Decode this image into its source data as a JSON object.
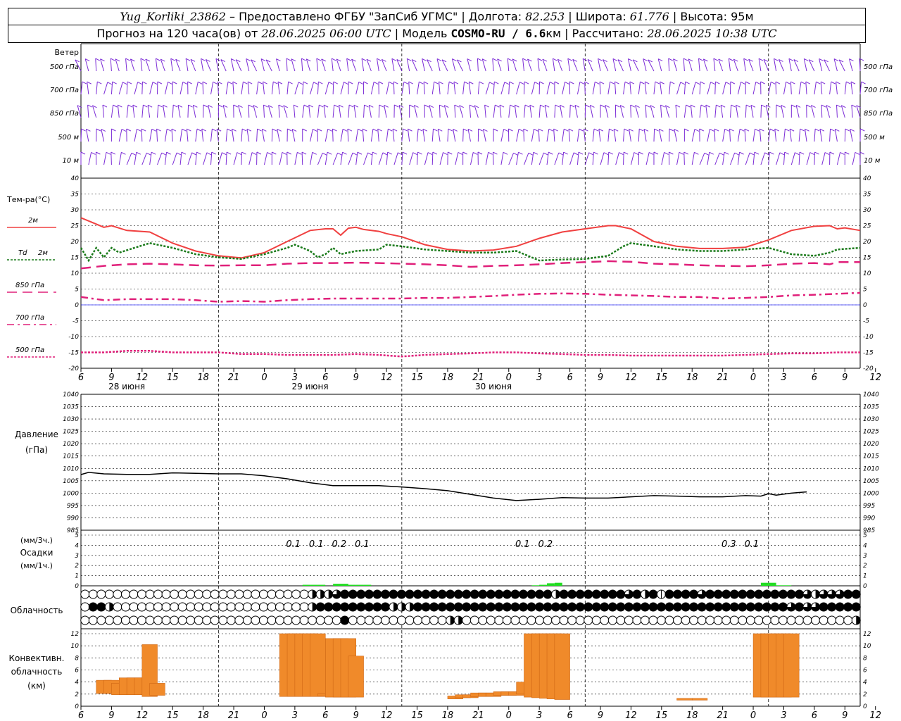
{
  "header": {
    "station": "Yug_Korliki_23862",
    "provider": " – Предоставлено ФГБУ \"ЗапСиб УГМС\" | Долгота: ",
    "lon": "82.253",
    "lat_label": " | Широта: ",
    "lat": "61.776",
    "alt_label": " | Высота: 95м",
    "forecast_prefix": "Прогноз на 120 часа(ов) от ",
    "forecast_from": "28.06.2025 06:00 UTC",
    "model_label": "  | Модель ",
    "model_name": "COSMO-RU / 6.6",
    "model_unit": "км | Рассчитано: ",
    "computed": "28.06.2025 10:38 UTC"
  },
  "labels": {
    "wind": "Ветер",
    "wind_levels": [
      "500 гПа",
      "700 гПа",
      "850 гПа",
      "500 м",
      "10 м"
    ],
    "temp": "Тем-ра(°C)",
    "t2m": "2м",
    "td_a": "Td",
    "td_b": "2м",
    "t850": "850 гПа",
    "t700": "700 гПа",
    "t500": "500 гПа",
    "pressure_a": "Давление",
    "pressure_b": "(гПа)",
    "precip_a": "(мм/3ч.)",
    "precip_b": "Осадки",
    "precip_c": "(мм/1ч.)",
    "cloud": "Облачность",
    "conv_a": "Конвективн.",
    "conv_b": "облачность",
    "conv_c": "(км)"
  },
  "chart_data": {
    "type": "meteogram",
    "colors": {
      "t2m": "#f04040",
      "td": "#1a7a1a",
      "t850": "#e0207a",
      "t700": "#e0207a",
      "t500": "#e0207a",
      "wind": "#7b2bd6",
      "precip": "#22dd22",
      "conv": "#f08a2a",
      "zero_line": "#3030ff"
    },
    "hours_range": [
      0,
      102
    ],
    "hour_ticks": [
      "6",
      "9",
      "12",
      "15",
      "18",
      "21",
      "0",
      "3",
      "6",
      "9",
      "12",
      "15",
      "18",
      "21",
      "0",
      "3",
      "6",
      "9",
      "12",
      "15",
      "18",
      "21",
      "0",
      "3",
      "6",
      "9",
      "12"
    ],
    "day_labels": [
      {
        "text": "28 июня",
        "hour": 6
      },
      {
        "text": "29 июня",
        "hour": 30
      },
      {
        "text": "30 июня",
        "hour": 54
      }
    ],
    "temperature": {
      "ylim": [
        -20,
        40
      ],
      "ticks": [
        40,
        35,
        30,
        25,
        20,
        15,
        10,
        5,
        0,
        -5,
        -10,
        -15,
        -20
      ],
      "t2m": [
        [
          0,
          27.5
        ],
        [
          3,
          24.5
        ],
        [
          4,
          25
        ],
        [
          6,
          23.5
        ],
        [
          9,
          23
        ],
        [
          12,
          19.5
        ],
        [
          15,
          17
        ],
        [
          18,
          15.5
        ],
        [
          21,
          14.8
        ],
        [
          24,
          16.5
        ],
        [
          27,
          20
        ],
        [
          30,
          23.5
        ],
        [
          32,
          24
        ],
        [
          33,
          24
        ],
        [
          34,
          22
        ],
        [
          35,
          24.2
        ],
        [
          36,
          24.5
        ],
        [
          37,
          23.8
        ],
        [
          39,
          23.2
        ],
        [
          40,
          22.5
        ],
        [
          42,
          21.5
        ],
        [
          45,
          19
        ],
        [
          48,
          17.5
        ],
        [
          51,
          17
        ],
        [
          54,
          17.3
        ],
        [
          57,
          18.5
        ],
        [
          60,
          21
        ],
        [
          63,
          23
        ],
        [
          66,
          24
        ],
        [
          69,
          25
        ],
        [
          70,
          25
        ],
        [
          72,
          24
        ],
        [
          75,
          20
        ],
        [
          78,
          18.5
        ],
        [
          81,
          17.8
        ],
        [
          84,
          17.8
        ],
        [
          87,
          18.2
        ],
        [
          90,
          20.5
        ],
        [
          93,
          23.5
        ],
        [
          96,
          24.8
        ],
        [
          98,
          25
        ],
        [
          99,
          24
        ],
        [
          100,
          24.3
        ],
        [
          102,
          23.5
        ]
      ],
      "td": [
        [
          0,
          18
        ],
        [
          1,
          14
        ],
        [
          2,
          18
        ],
        [
          3,
          15
        ],
        [
          4,
          18
        ],
        [
          5,
          16.5
        ],
        [
          7,
          18
        ],
        [
          9,
          19.5
        ],
        [
          12,
          18
        ],
        [
          15,
          16
        ],
        [
          18,
          15
        ],
        [
          21,
          14.5
        ],
        [
          24,
          16
        ],
        [
          27,
          18
        ],
        [
          28,
          19
        ],
        [
          30,
          17
        ],
        [
          31,
          15
        ],
        [
          32,
          16
        ],
        [
          33,
          18
        ],
        [
          34,
          16
        ],
        [
          36,
          17
        ],
        [
          39,
          17.5
        ],
        [
          40,
          19
        ],
        [
          42,
          18.5
        ],
        [
          45,
          17.5
        ],
        [
          48,
          17
        ],
        [
          51,
          16.5
        ],
        [
          54,
          16.5
        ],
        [
          57,
          17
        ],
        [
          59,
          15
        ],
        [
          60,
          14
        ],
        [
          63,
          14.3
        ],
        [
          66,
          14.5
        ],
        [
          69,
          15.5
        ],
        [
          71,
          18.5
        ],
        [
          72,
          19.5
        ],
        [
          75,
          18.5
        ],
        [
          78,
          17.5
        ],
        [
          81,
          17
        ],
        [
          84,
          17
        ],
        [
          87,
          17.5
        ],
        [
          90,
          18
        ],
        [
          93,
          16
        ],
        [
          96,
          15.5
        ],
        [
          98,
          16.5
        ],
        [
          99,
          17.5
        ],
        [
          102,
          18
        ]
      ],
      "t850": [
        [
          0,
          11.5
        ],
        [
          3,
          12.3
        ],
        [
          6,
          12.8
        ],
        [
          9,
          13
        ],
        [
          12,
          12.8
        ],
        [
          15,
          12.5
        ],
        [
          18,
          12.4
        ],
        [
          21,
          12.5
        ],
        [
          24,
          12.5
        ],
        [
          27,
          13
        ],
        [
          30,
          13.2
        ],
        [
          33,
          13.2
        ],
        [
          36,
          13.3
        ],
        [
          39,
          13.2
        ],
        [
          42,
          13
        ],
        [
          45,
          12.8
        ],
        [
          48,
          12.5
        ],
        [
          51,
          12
        ],
        [
          54,
          12.3
        ],
        [
          57,
          12.5
        ],
        [
          60,
          12.8
        ],
        [
          63,
          13.2
        ],
        [
          66,
          13.5
        ],
        [
          69,
          13.8
        ],
        [
          72,
          13.6
        ],
        [
          75,
          13
        ],
        [
          78,
          12.8
        ],
        [
          81,
          12.5
        ],
        [
          84,
          12.3
        ],
        [
          87,
          12.2
        ],
        [
          90,
          12.5
        ],
        [
          93,
          13
        ],
        [
          96,
          13.2
        ],
        [
          98,
          12.8
        ],
        [
          99,
          13.5
        ],
        [
          102,
          13.5
        ]
      ],
      "t700": [
        [
          0,
          2.5
        ],
        [
          3,
          1.5
        ],
        [
          6,
          1.8
        ],
        [
          9,
          1.8
        ],
        [
          12,
          1.8
        ],
        [
          15,
          1.5
        ],
        [
          18,
          1
        ],
        [
          21,
          1.2
        ],
        [
          24,
          1
        ],
        [
          27,
          1.5
        ],
        [
          30,
          1.8
        ],
        [
          33,
          2
        ],
        [
          36,
          2
        ],
        [
          39,
          2
        ],
        [
          42,
          2
        ],
        [
          45,
          2.2
        ],
        [
          48,
          2.2
        ],
        [
          51,
          2.5
        ],
        [
          54,
          2.8
        ],
        [
          57,
          3.2
        ],
        [
          60,
          3.5
        ],
        [
          63,
          3.6
        ],
        [
          66,
          3.5
        ],
        [
          69,
          3.2
        ],
        [
          72,
          3
        ],
        [
          75,
          2.8
        ],
        [
          78,
          2.5
        ],
        [
          81,
          2.5
        ],
        [
          84,
          2
        ],
        [
          87,
          2.2
        ],
        [
          90,
          2.5
        ],
        [
          93,
          3
        ],
        [
          96,
          3.2
        ],
        [
          99,
          3.5
        ],
        [
          102,
          3.8
        ]
      ],
      "t500": [
        [
          0,
          -15
        ],
        [
          3,
          -15
        ],
        [
          6,
          -14.5
        ],
        [
          9,
          -14.5
        ],
        [
          12,
          -15
        ],
        [
          15,
          -15
        ],
        [
          18,
          -15
        ],
        [
          21,
          -15.5
        ],
        [
          24,
          -15.5
        ],
        [
          27,
          -15.8
        ],
        [
          30,
          -15.8
        ],
        [
          33,
          -15.8
        ],
        [
          36,
          -15.5
        ],
        [
          39,
          -15.8
        ],
        [
          42,
          -16.3
        ],
        [
          45,
          -15.8
        ],
        [
          48,
          -15.5
        ],
        [
          51,
          -15.3
        ],
        [
          54,
          -15
        ],
        [
          57,
          -15
        ],
        [
          60,
          -15.3
        ],
        [
          63,
          -15.5
        ],
        [
          66,
          -15.8
        ],
        [
          69,
          -15.8
        ],
        [
          72,
          -16
        ],
        [
          75,
          -16
        ],
        [
          78,
          -16
        ],
        [
          81,
          -16
        ],
        [
          84,
          -16
        ],
        [
          87,
          -15.8
        ],
        [
          90,
          -15.5
        ],
        [
          93,
          -15.3
        ],
        [
          96,
          -15.3
        ],
        [
          99,
          -15
        ],
        [
          102,
          -15
        ]
      ]
    },
    "pressure": {
      "ylim": [
        985,
        1040
      ],
      "ticks": [
        1040,
        1035,
        1030,
        1025,
        1020,
        1015,
        1010,
        1005,
        1000,
        995,
        990,
        985
      ],
      "values": [
        [
          0,
          1007.5
        ],
        [
          1,
          1008.4
        ],
        [
          3,
          1007.8
        ],
        [
          6,
          1007.6
        ],
        [
          9,
          1007.6
        ],
        [
          12,
          1008.2
        ],
        [
          15,
          1008
        ],
        [
          18,
          1007.8
        ],
        [
          21,
          1007.8
        ],
        [
          24,
          1007
        ],
        [
          27,
          1005.8
        ],
        [
          30,
          1004.2
        ],
        [
          33,
          1003
        ],
        [
          36,
          1003
        ],
        [
          39,
          1003
        ],
        [
          42,
          1002.5
        ],
        [
          45,
          1001.8
        ],
        [
          48,
          1001
        ],
        [
          51,
          999.5
        ],
        [
          54,
          998
        ],
        [
          57,
          997
        ],
        [
          60,
          997.5
        ],
        [
          63,
          998.2
        ],
        [
          66,
          998
        ],
        [
          69,
          998
        ],
        [
          72,
          998.5
        ],
        [
          75,
          999
        ],
        [
          78,
          998.8
        ],
        [
          81,
          998.5
        ],
        [
          84,
          998.5
        ],
        [
          87,
          999
        ],
        [
          89,
          998.8
        ],
        [
          90,
          999.8
        ],
        [
          91,
          999.2
        ],
        [
          93,
          1000
        ],
        [
          95,
          1000.5
        ]
      ]
    },
    "precip": {
      "ylim": [
        0,
        5
      ],
      "ticks": [
        5,
        4,
        3,
        2,
        1,
        0
      ],
      "labels": [
        {
          "hour": 27.8,
          "text": "0.1"
        },
        {
          "hour": 30.8,
          "text": "0.1"
        },
        {
          "hour": 33.8,
          "text": "0.2"
        },
        {
          "hour": 36.8,
          "text": "0.1"
        },
        {
          "hour": 57.8,
          "text": "0.1"
        },
        {
          "hour": 60.8,
          "text": "0.2"
        },
        {
          "hour": 84.8,
          "text": "0.3"
        },
        {
          "hour": 87.8,
          "text": "0.1"
        }
      ],
      "bars": [
        [
          29,
          0.1
        ],
        [
          30,
          0.1
        ],
        [
          31,
          0.1
        ],
        [
          33,
          0.2
        ],
        [
          34,
          0.2
        ],
        [
          35,
          0.1
        ],
        [
          36,
          0.1
        ],
        [
          37,
          0.1
        ],
        [
          59,
          0.05
        ],
        [
          60,
          0.1
        ],
        [
          61,
          0.25
        ],
        [
          62,
          0.3
        ],
        [
          89,
          0.3
        ],
        [
          90,
          0.3
        ],
        [
          91,
          0.05
        ],
        [
          92,
          0.05
        ]
      ]
    },
    "cloud_rows": [
      "000000000000000000000000000022234444444444444444444444444424444444434241444434444444444443233344",
      "044200000000000000000000000024444444442224444444444444444444444444444444444444444444444343344444",
      "000000000000000000000000000000004000000000000220000000000000000000000000000000000000000000000002"
    ],
    "convective": {
      "ylim": [
        0,
        12
      ],
      "ticks": [
        12,
        10,
        8,
        6,
        4,
        2,
        0
      ],
      "bars": [
        [
          0,
          2.1,
          4.3
        ],
        [
          1,
          2.1,
          4.3
        ],
        [
          2,
          1.9,
          3.8
        ],
        [
          3,
          1.9,
          4.7
        ],
        [
          4,
          1.9,
          4.7
        ],
        [
          5,
          1.9,
          4.7
        ],
        [
          6,
          1.6,
          10.2
        ],
        [
          7,
          1.8,
          3.8
        ],
        [
          24,
          1.6,
          12
        ],
        [
          25,
          1.6,
          12
        ],
        [
          26,
          1.6,
          12
        ],
        [
          27,
          1.6,
          12
        ],
        [
          28,
          1.6,
          12
        ],
        [
          29,
          1.7,
          2.1
        ],
        [
          30,
          1.5,
          11.2
        ],
        [
          31,
          1.5,
          11.2
        ],
        [
          32,
          1.5,
          11.2
        ],
        [
          33,
          1.5,
          8.3
        ],
        [
          46,
          1.2,
          1.7
        ],
        [
          47,
          1.4,
          1.9
        ],
        [
          48,
          1.4,
          1.9
        ],
        [
          49,
          1.6,
          2.2
        ],
        [
          50,
          1.6,
          2.2
        ],
        [
          51,
          1.6,
          2.2
        ],
        [
          52,
          1.8,
          2.4
        ],
        [
          53,
          1.8,
          2.4
        ],
        [
          54,
          1.8,
          2.4
        ],
        [
          55,
          2.0,
          4.0
        ],
        [
          56,
          1.5,
          12
        ],
        [
          57,
          1.4,
          12
        ],
        [
          58,
          1.3,
          12
        ],
        [
          59,
          1.2,
          12
        ],
        [
          60,
          1.1,
          12
        ],
        [
          76,
          1.0,
          1.3
        ],
        [
          78,
          1.0,
          1.3
        ],
        [
          86,
          1.5,
          12
        ],
        [
          87,
          1.5,
          12
        ],
        [
          88,
          1.5,
          12
        ],
        [
          89,
          1.5,
          12
        ],
        [
          90,
          1.5,
          12
        ]
      ]
    }
  }
}
